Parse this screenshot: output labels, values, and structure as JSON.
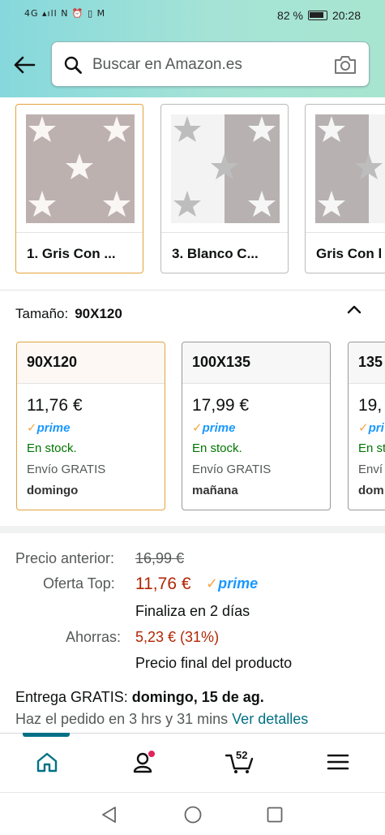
{
  "status_bar": {
    "left_icons": "4G ▴ıll N ⏰ ▯ M",
    "battery_percent": "82 %",
    "time": "20:28"
  },
  "search": {
    "placeholder": "Buscar en Amazon.es"
  },
  "colors": {
    "accent_selected": "#e3a33d",
    "price_red": "#b12704",
    "in_stock_green": "#007600",
    "prime_blue": "#1a98ff",
    "link_teal": "#007185"
  },
  "color_variants": [
    {
      "label": "1. Gris Con ...",
      "selected": true,
      "pattern": "gray-stars"
    },
    {
      "label": "3. Blanco C...",
      "selected": false,
      "pattern": "white-gray-stars"
    },
    {
      "label": "Gris Con l",
      "selected": false,
      "pattern": "gray-white-stars"
    }
  ],
  "size": {
    "label": "Tamaño:",
    "selected": "90X120",
    "options": [
      {
        "name": "90X120",
        "price": "11,76 €",
        "prime": "prime",
        "stock": "En stock.",
        "shipping": "Envío GRATIS",
        "day": "domingo"
      },
      {
        "name": "100X135",
        "price": "17,99 €",
        "prime": "prime",
        "stock": "En stock.",
        "shipping": "Envío GRATIS",
        "day": "mañana"
      },
      {
        "name": "135",
        "price": "19,",
        "prime": "pri",
        "stock": "En st",
        "shipping": "Enví",
        "day": "dom"
      }
    ]
  },
  "pricing": {
    "previous_label": "Precio anterior:",
    "previous_price": "16,99 €",
    "offer_label": "Oferta Top:",
    "offer_price": "11,76 €",
    "prime": "prime",
    "ends": "Finaliza en 2 días",
    "savings_label": "Ahorras:",
    "savings": "5,23 € (31%)",
    "final_note": "Precio final del producto"
  },
  "delivery": {
    "label": "Entrega GRATIS:",
    "date": "domingo, 15 de ag.",
    "order_within": "Haz el pedido en 3 hrs y 31 mins",
    "details_link": "Ver detalles"
  },
  "bottom_nav": {
    "cart_count": "52"
  }
}
